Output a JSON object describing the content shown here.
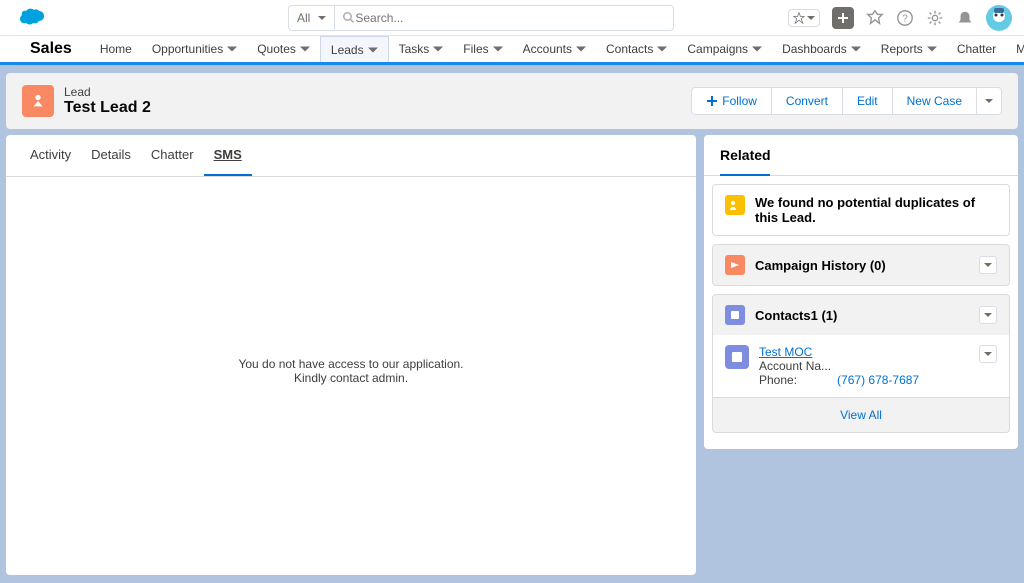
{
  "search": {
    "scope": "All",
    "placeholder": "Search..."
  },
  "app_name": "Sales",
  "nav": [
    "Home",
    "Opportunities",
    "Quotes",
    "Leads",
    "Tasks",
    "Files",
    "Accounts",
    "Contacts",
    "Campaigns",
    "Dashboards",
    "Reports",
    "Chatter",
    "More"
  ],
  "nav_active_index": 3,
  "record": {
    "object": "Lead",
    "name": "Test Lead 2",
    "actions": {
      "follow": "Follow",
      "convert": "Convert",
      "edit": "Edit",
      "new_case": "New Case"
    }
  },
  "tabs": [
    "Activity",
    "Details",
    "Chatter",
    "SMS"
  ],
  "tabs_active_index": 3,
  "sms_error_line1": "You do not have access to our application.",
  "sms_error_line2": "Kindly contact admin.",
  "related": {
    "title": "Related",
    "duplicates": "We found no potential duplicates of this Lead.",
    "campaign_history": "Campaign History (0)",
    "contacts_title": "Contacts1 (1)",
    "contact": {
      "name": "Test MOC",
      "account_label": "Account Na...",
      "phone_label": "Phone:",
      "phone": "(767) 678-7687"
    },
    "view_all": "View All"
  }
}
